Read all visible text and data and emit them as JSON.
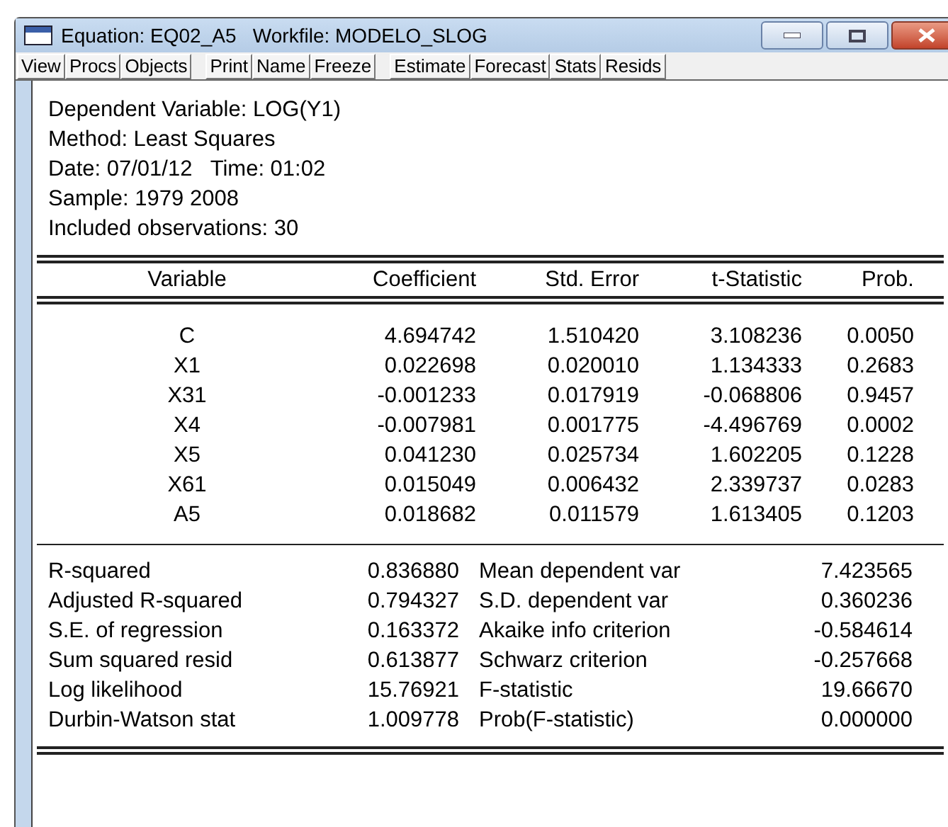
{
  "window": {
    "title": "Equation: EQ02_A5   Workfile: MODELO_SLOG"
  },
  "toolbar_groups": [
    [
      "View",
      "Procs",
      "Objects"
    ],
    [
      "Print",
      "Name",
      "Freeze"
    ],
    [
      "Estimate",
      "Forecast",
      "Stats",
      "Resids"
    ]
  ],
  "header_lines": [
    "Dependent Variable: LOG(Y1)",
    "Method: Least Squares",
    "Date: 07/01/12   Time: 01:02",
    "Sample: 1979 2008",
    "Included observations: 30"
  ],
  "table": {
    "columns": [
      "Variable",
      "Coefficient",
      "Std. Error",
      "t-Statistic",
      "Prob."
    ],
    "rows": [
      [
        "C",
        "4.694742",
        "1.510420",
        "3.108236",
        "0.0050"
      ],
      [
        "X1",
        "0.022698",
        "0.020010",
        "1.134333",
        "0.2683"
      ],
      [
        "X31",
        "-0.001233",
        "0.017919",
        "-0.068806",
        "0.9457"
      ],
      [
        "X4",
        "-0.007981",
        "0.001775",
        "-4.496769",
        "0.0002"
      ],
      [
        "X5",
        "0.041230",
        "0.025734",
        "1.602205",
        "0.1228"
      ],
      [
        "X61",
        "0.015049",
        "0.006432",
        "2.339737",
        "0.0283"
      ],
      [
        "A5",
        "0.018682",
        "0.011579",
        "1.613405",
        "0.1203"
      ]
    ]
  },
  "statistics": [
    [
      "R-squared",
      "0.836880",
      "Mean dependent var",
      "7.423565"
    ],
    [
      "Adjusted R-squared",
      "0.794327",
      "S.D. dependent var",
      "0.360236"
    ],
    [
      "S.E. of regression",
      "0.163372",
      "Akaike info criterion",
      "-0.584614"
    ],
    [
      "Sum squared resid",
      "0.613877",
      "Schwarz criterion",
      "-0.257668"
    ],
    [
      "Log likelihood",
      "15.76921",
      "F-statistic",
      "19.66670"
    ],
    [
      "Durbin-Watson stat",
      "1.009778",
      "Prob(F-statistic)",
      "0.000000"
    ]
  ]
}
